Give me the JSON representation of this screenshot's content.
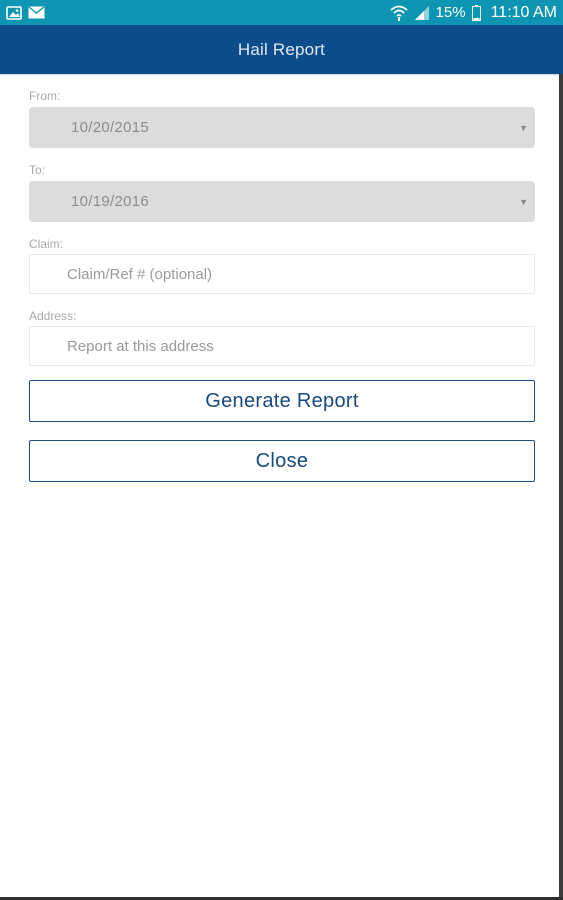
{
  "status_bar": {
    "icons_left": [
      "image-icon",
      "mail-icon"
    ],
    "icons_right": [
      "wifi-icon",
      "signal-icon",
      "battery-icon"
    ],
    "battery": "15%",
    "time": "11:10 AM",
    "background": "#0e95b1"
  },
  "header": {
    "title": "Hail Report",
    "background": "#0d4c8b"
  },
  "form": {
    "from": {
      "label": "From:",
      "value": "10/20/2015"
    },
    "to": {
      "label": "To:",
      "value": "10/19/2016"
    },
    "claim": {
      "label": "Claim:",
      "placeholder": "Claim/Ref # (optional)",
      "value": ""
    },
    "address": {
      "label": "Address:",
      "placeholder": "Report at this address",
      "value": ""
    }
  },
  "buttons": {
    "generate": "Generate Report",
    "close": "Close"
  },
  "colors": {
    "accent": "#174a80",
    "select_bg": "#dcdcdc"
  }
}
